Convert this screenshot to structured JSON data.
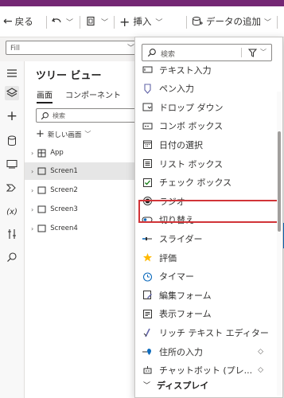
{
  "command_bar": {
    "back_label": "戻る",
    "insert_label": "挿入",
    "add_data_label": "データの追加"
  },
  "property_bar": {
    "value": "Fill"
  },
  "tree_view": {
    "title": "ツリー ビュー",
    "tabs": [
      "画面",
      "コンポーネント"
    ],
    "search_placeholder": "検索",
    "new_screen_label": "新しい画面",
    "items": [
      {
        "label": "App"
      },
      {
        "label": "Screen1"
      },
      {
        "label": "Screen2"
      },
      {
        "label": "Screen3"
      },
      {
        "label": "Screen4"
      }
    ]
  },
  "insert_menu": {
    "search_placeholder": "検索",
    "items": [
      {
        "label": "テキスト入力",
        "icon": "text-input-icon"
      },
      {
        "label": "ペン入力",
        "icon": "pen-input-icon"
      },
      {
        "label": "ドロップ ダウン",
        "icon": "dropdown-icon"
      },
      {
        "label": "コンボ ボックス",
        "icon": "combobox-icon"
      },
      {
        "label": "日付の選択",
        "icon": "date-picker-icon"
      },
      {
        "label": "リスト ボックス",
        "icon": "list-box-icon"
      },
      {
        "label": "チェック ボックス",
        "icon": "checkbox-icon"
      },
      {
        "label": "ラジオ",
        "icon": "radio-icon"
      },
      {
        "label": "切り替え",
        "icon": "toggle-icon"
      },
      {
        "label": "スライダー",
        "icon": "slider-icon"
      },
      {
        "label": "評価",
        "icon": "rating-star-icon"
      },
      {
        "label": "タイマー",
        "icon": "timer-icon"
      },
      {
        "label": "編集フォーム",
        "icon": "edit-form-icon"
      },
      {
        "label": "表示フォーム",
        "icon": "display-form-icon"
      },
      {
        "label": "リッチ テキスト エディター",
        "icon": "rich-text-editor-icon"
      },
      {
        "label": "住所の入力",
        "icon": "address-input-icon"
      },
      {
        "label": "チャットボット (プレ...",
        "icon": "chatbot-icon"
      }
    ],
    "section_label": "ディスプレイ",
    "highlighted_item": "切り替え",
    "highlight_color": "#d13438"
  },
  "colors": {
    "brand": "#742774",
    "accent": "#0f6cbd"
  }
}
